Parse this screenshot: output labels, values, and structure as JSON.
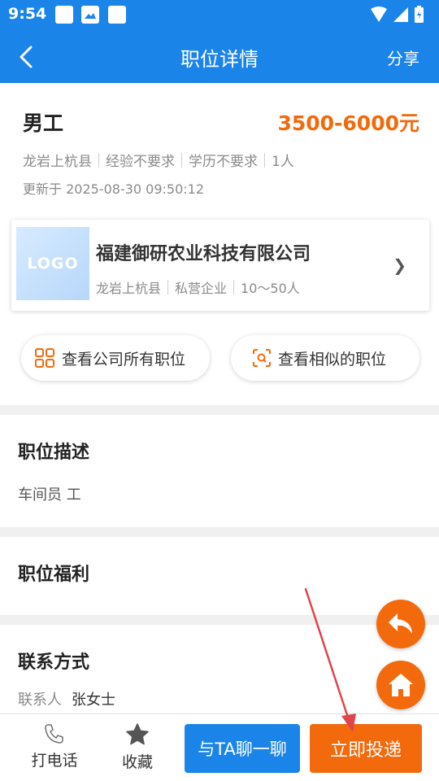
{
  "status_bar": {
    "time": "9:54"
  },
  "app_bar": {
    "title": "职位详情",
    "share": "分享"
  },
  "job": {
    "title": "男工",
    "salary": "3500-6000元",
    "location": "龙岩上杭县",
    "experience": "经验不要求",
    "education": "学历不要求",
    "headcount": "1人",
    "updated": "更新于 2025-08-30 09:50:12"
  },
  "company": {
    "logo_text": "LOGO",
    "name": "福建御研农业科技有限公司",
    "location": "龙岩上杭县",
    "type": "私营企业",
    "size": "10～50人"
  },
  "actions": {
    "all_positions": "查看公司所有职位",
    "similar_positions": "查看相似的职位"
  },
  "description": {
    "title": "职位描述",
    "text": "车间员 工"
  },
  "benefits": {
    "title": "职位福利"
  },
  "contact": {
    "title": "联系方式",
    "label": "联系人",
    "name": "张女士"
  },
  "bottom_bar": {
    "call": "打电话",
    "favorite": "收藏",
    "chat": "与TA聊一聊",
    "apply": "立即投递"
  },
  "colors": {
    "primary": "#1a84e9",
    "accent": "#f26a0c",
    "annotation_arrow": "#e0454a"
  }
}
